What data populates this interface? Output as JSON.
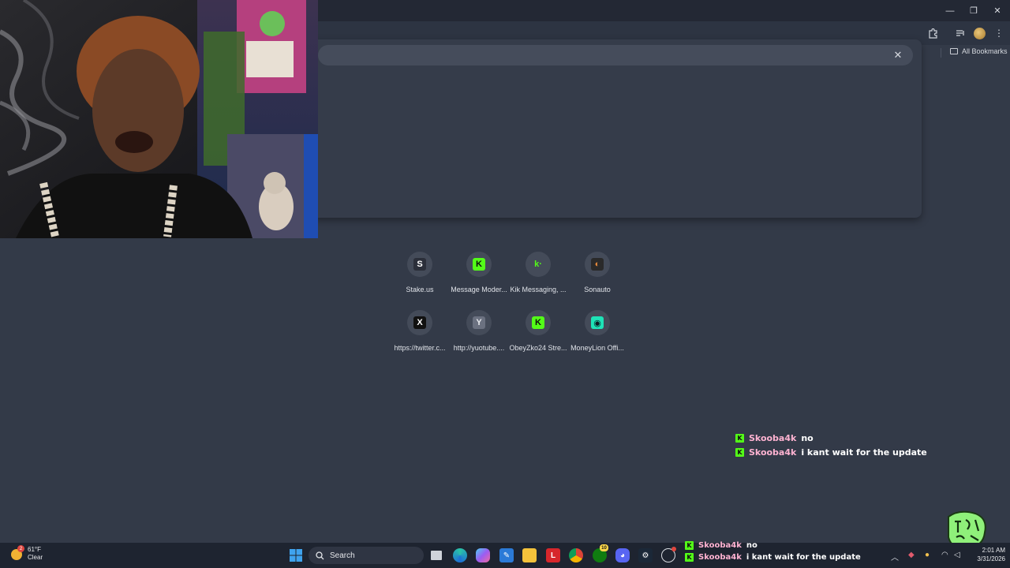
{
  "browser": {
    "bookmarks_label": "All Bookmarks",
    "omnibox_clear_glyph": "✕"
  },
  "shortcuts": [
    {
      "label": "Stake.us",
      "icon": "stake-icon",
      "glyph": "S",
      "bg": "#2b2f3a",
      "fg": "#ffffff"
    },
    {
      "label": "Message Moder...",
      "icon": "kick-icon",
      "glyph": "K",
      "bg": "#53fc18",
      "fg": "#0d0d0d"
    },
    {
      "label": "Kik Messaging, ...",
      "icon": "kik-icon",
      "glyph": "k·",
      "bg": "transparent",
      "fg": "#53fc18"
    },
    {
      "label": "Sonauto",
      "icon": "sonauto-icon",
      "glyph": "◐",
      "bg": "#2a2a2a",
      "fg": "#e8893a"
    },
    {
      "label": "https://twitter.c...",
      "icon": "x-icon",
      "glyph": "X",
      "bg": "#111111",
      "fg": "#ffffff"
    },
    {
      "label": "http://yuotube....",
      "icon": "youtube-letter-icon",
      "glyph": "Y",
      "bg": "#6b7180",
      "fg": "#e6e8ec"
    },
    {
      "label": "ObeyZko24 Stre...",
      "icon": "kick-icon",
      "glyph": "K",
      "bg": "#53fc18",
      "fg": "#0d0d0d"
    },
    {
      "label": "MoneyLion Offi...",
      "icon": "moneylion-icon",
      "glyph": "◉",
      "bg": "#1ee3b7",
      "fg": "#0b1a22"
    }
  ],
  "chat": [
    {
      "user": "Skooba4k",
      "message": "no"
    },
    {
      "user": "Skooba4k",
      "message": "i kant wait for the update"
    }
  ],
  "taskbar": {
    "weather_temp": "61°F",
    "weather_desc": "Clear",
    "weather_badge": "2",
    "search_placeholder": "Search",
    "xbox_badge": "10",
    "time": "2:01 AM",
    "date": "3/31/2026",
    "chat": [
      {
        "user": "Skooba4k",
        "message": "no"
      },
      {
        "user": "Skooba4k",
        "message": "i kant wait for the update"
      }
    ]
  },
  "colors": {
    "page_bg": "#333a48",
    "kick_green": "#53fc18",
    "chat_user": "#ffb3d2"
  }
}
